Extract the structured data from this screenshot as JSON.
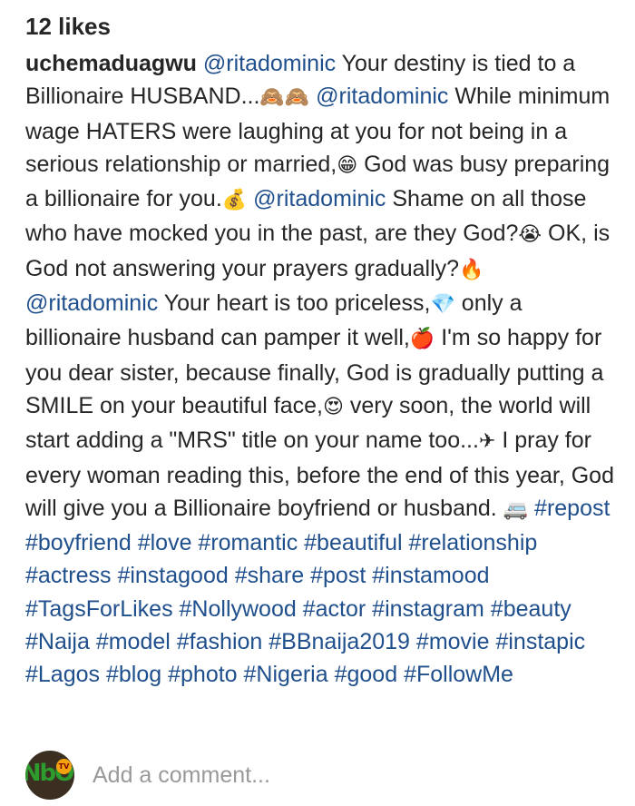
{
  "post": {
    "likes": "12 likes",
    "username": "uchemaduagwu",
    "caption": [
      {
        "type": "mention",
        "text": "@ritadominic"
      },
      {
        "type": "text",
        "text": " Your destiny is tied to a Billionaire HUSBAND..."
      },
      {
        "type": "emoji",
        "text": "🙈🙈"
      },
      {
        "type": "text",
        "text": " "
      },
      {
        "type": "mention",
        "text": "@ritadominic"
      },
      {
        "type": "text",
        "text": " While minimum wage HATERS were laughing at you for not being in a serious relationship or married,"
      },
      {
        "type": "emoji",
        "text": "😁"
      },
      {
        "type": "text",
        "text": " God was busy preparing a billionaire for you."
      },
      {
        "type": "emoji",
        "text": "💰"
      },
      {
        "type": "text",
        "text": " "
      },
      {
        "type": "mention",
        "text": "@ritadominic"
      },
      {
        "type": "text",
        "text": " Shame on all those who have mocked you in the past, are they God?"
      },
      {
        "type": "emoji",
        "text": "😭"
      },
      {
        "type": "text",
        "text": " OK, is God not answering your prayers gradually?"
      },
      {
        "type": "emoji",
        "text": "🔥"
      },
      {
        "type": "text",
        "text": " "
      },
      {
        "type": "mention",
        "text": "@ritadominic"
      },
      {
        "type": "text",
        "text": " Your heart is too priceless,"
      },
      {
        "type": "emoji",
        "text": "💎"
      },
      {
        "type": "text",
        "text": " only a billionaire husband can pamper it well,"
      },
      {
        "type": "emoji",
        "text": "🍎"
      },
      {
        "type": "text",
        "text": " I'm so happy for you dear sister, because finally, God is gradually putting a SMILE on your beautiful face,"
      },
      {
        "type": "emoji",
        "text": "😍"
      },
      {
        "type": "text",
        "text": " very soon, the world will start adding a \"MRS\" title on your name too..."
      },
      {
        "type": "emoji",
        "text": "✈"
      },
      {
        "type": "text",
        "text": " I pray for every woman reading this, before the end of this year, God will give you a Billionaire boyfriend or husband. "
      },
      {
        "type": "emoji",
        "text": "🚐"
      },
      {
        "type": "text",
        "text": " "
      },
      {
        "type": "tag",
        "text": "#repost"
      },
      {
        "type": "text",
        "text": " "
      },
      {
        "type": "tag",
        "text": "#boyfriend"
      },
      {
        "type": "text",
        "text": " "
      },
      {
        "type": "tag",
        "text": "#love"
      },
      {
        "type": "text",
        "text": " "
      },
      {
        "type": "tag",
        "text": "#romantic"
      },
      {
        "type": "text",
        "text": " "
      },
      {
        "type": "tag",
        "text": "#beautiful"
      },
      {
        "type": "text",
        "text": " "
      },
      {
        "type": "tag",
        "text": "#relationship"
      },
      {
        "type": "text",
        "text": " "
      },
      {
        "type": "tag",
        "text": "#actress"
      },
      {
        "type": "text",
        "text": " "
      },
      {
        "type": "tag",
        "text": "#instagood"
      },
      {
        "type": "text",
        "text": " "
      },
      {
        "type": "tag",
        "text": "#share"
      },
      {
        "type": "text",
        "text": " "
      },
      {
        "type": "tag",
        "text": "#post"
      },
      {
        "type": "text",
        "text": " "
      },
      {
        "type": "tag",
        "text": "#instamood"
      },
      {
        "type": "text",
        "text": " "
      },
      {
        "type": "tag",
        "text": "#TagsForLikes"
      },
      {
        "type": "text",
        "text": " "
      },
      {
        "type": "tag",
        "text": "#Nollywood"
      },
      {
        "type": "text",
        "text": " "
      },
      {
        "type": "tag",
        "text": "#actor"
      },
      {
        "type": "text",
        "text": " "
      },
      {
        "type": "tag",
        "text": "#instagram"
      },
      {
        "type": "text",
        "text": " "
      },
      {
        "type": "tag",
        "text": "#beauty"
      },
      {
        "type": "text",
        "text": " "
      },
      {
        "type": "tag",
        "text": "#Naija"
      },
      {
        "type": "text",
        "text": " "
      },
      {
        "type": "tag",
        "text": "#model"
      },
      {
        "type": "text",
        "text": " "
      },
      {
        "type": "tag",
        "text": "#fashion"
      },
      {
        "type": "text",
        "text": " "
      },
      {
        "type": "tag",
        "text": "#BBnaija2019"
      },
      {
        "type": "text",
        "text": " "
      },
      {
        "type": "tag",
        "text": "#movie"
      },
      {
        "type": "text",
        "text": " "
      },
      {
        "type": "tag",
        "text": "#instapic"
      },
      {
        "type": "text",
        "text": " "
      },
      {
        "type": "tag",
        "text": "#Lagos"
      },
      {
        "type": "text",
        "text": " "
      },
      {
        "type": "tag",
        "text": "#blog"
      },
      {
        "type": "text",
        "text": " "
      },
      {
        "type": "tag",
        "text": "#photo"
      },
      {
        "type": "text",
        "text": " "
      },
      {
        "type": "tag",
        "text": "#Nigeria"
      },
      {
        "type": "text",
        "text": " "
      },
      {
        "type": "tag",
        "text": "#good"
      },
      {
        "type": "text",
        "text": " "
      },
      {
        "type": "tag",
        "text": "#FollowMe"
      }
    ]
  },
  "comment": {
    "placeholder": "Add a comment...",
    "avatar_logo": "NbO",
    "avatar_badge": "TV"
  },
  "colors": {
    "link": "#1f4f8c",
    "text": "#262626",
    "placeholder": "#999999"
  }
}
